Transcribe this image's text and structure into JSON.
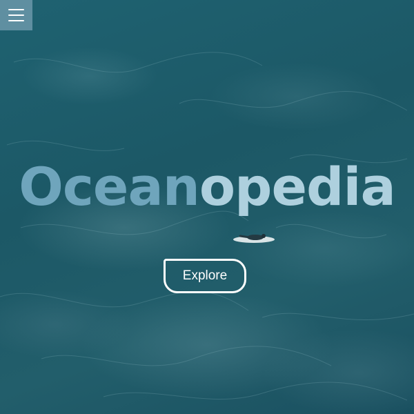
{
  "header": {
    "menu_icon": "hamburger-menu-icon"
  },
  "hero": {
    "title_part_1": "Ocean",
    "title_part_2": "opedia",
    "explore_label": "Explore",
    "colors": {
      "menu_button_bg": "#5f8fa1",
      "title_part_1": "#6fa5bc",
      "title_part_2": "#aed0de",
      "button_border": "#ffffff"
    }
  }
}
